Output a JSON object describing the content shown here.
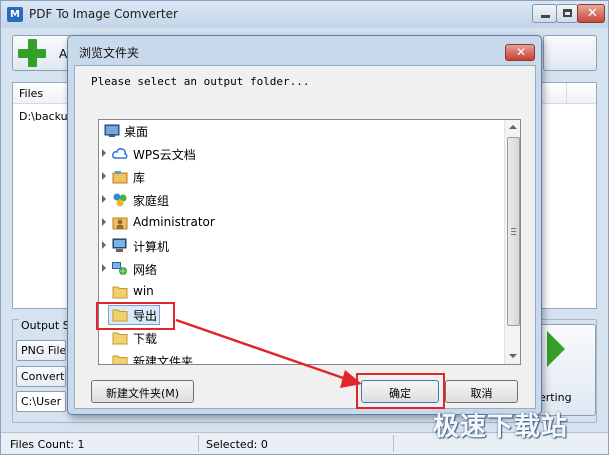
{
  "main_window": {
    "title": "PDF To Image Comverter",
    "logo_text": "M",
    "add_button_label": "Ad",
    "files_header": "Files",
    "file_path": "D:\\backup",
    "output_settings_label": "Output Se",
    "format_value": "PNG File",
    "convert_option_value": "Convert",
    "output_path_value": "C:\\User",
    "start_button_label": "erting",
    "status": {
      "files_count": "Files Count: 1",
      "selected": "Selected: 0"
    }
  },
  "dialog": {
    "title": "浏览文件夹",
    "close_label": "✕",
    "prompt": "Please select an output folder...",
    "tree_items": [
      {
        "label": "桌面",
        "icon": "desktop-icon",
        "expandable": false
      },
      {
        "label": "WPS云文档",
        "icon": "cloud-icon",
        "expandable": true
      },
      {
        "label": "库",
        "icon": "library-icon",
        "expandable": true
      },
      {
        "label": "家庭组",
        "icon": "homegroup-icon",
        "expandable": true
      },
      {
        "label": "Administrator",
        "icon": "user-folder-icon",
        "expandable": true
      },
      {
        "label": "计算机",
        "icon": "computer-icon",
        "expandable": true
      },
      {
        "label": "网络",
        "icon": "network-icon",
        "expandable": true
      },
      {
        "label": "win",
        "icon": "folder-icon",
        "expandable": false
      },
      {
        "label": "导出",
        "icon": "folder-icon",
        "expandable": false,
        "selected": true
      },
      {
        "label": "下载",
        "icon": "folder-icon",
        "expandable": false
      },
      {
        "label": "新建文件夹",
        "icon": "folder-icon",
        "expandable": false
      }
    ],
    "buttons": {
      "new_folder": "新建文件夹(M)",
      "ok": "确定",
      "cancel": "取消"
    }
  },
  "annotation_color": "#e0262b",
  "watermark": "极速下载站"
}
